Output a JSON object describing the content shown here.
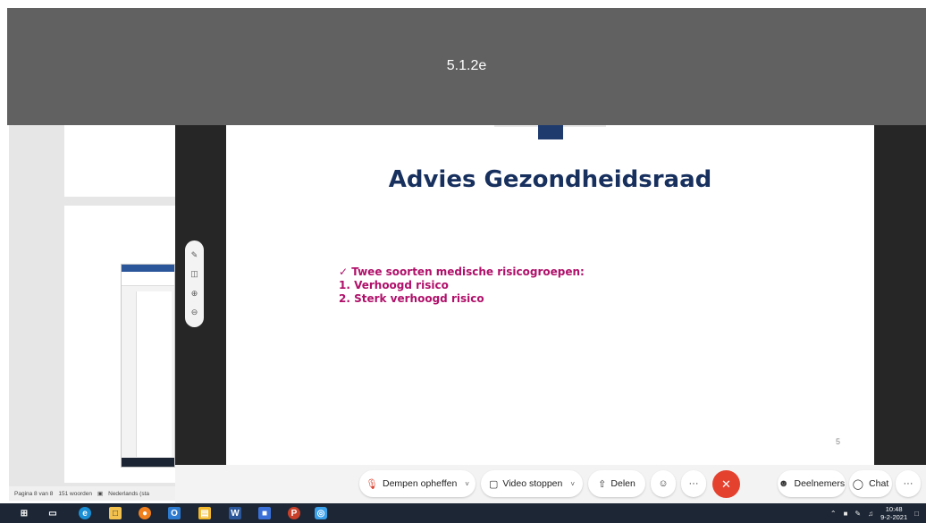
{
  "overlay": {
    "label": "5.1.2e"
  },
  "slide": {
    "title": "Advies Gezondheidsraad",
    "bullets": [
      "✓ Twee soorten medische risicogroepen:",
      "1.  Verhoogd risico",
      "2.  Sterk verhoogd risico"
    ],
    "page_number": "5"
  },
  "word": {
    "status_page": "Pagina 8 van 8",
    "status_words": "151 woorden",
    "status_language": "Nederlands (sta"
  },
  "controls": {
    "mute_label": "Dempen opheffen",
    "video_label": "Video stoppen",
    "share_label": "Delen",
    "more_label": "···",
    "participants_label": "Deelnemers",
    "chat_label": "Chat"
  },
  "icons": {
    "mic": "mic-off-icon",
    "video": "video-icon",
    "share": "share-icon",
    "reactions": "smiley-icon",
    "end": "close-icon"
  },
  "taskbar": {
    "time": "10:48",
    "date": "9-2-2021"
  },
  "colors": {
    "overlay": "#616161",
    "slide_title": "#17305e",
    "slide_bullets": "#b0106a",
    "end_call": "#e5412f",
    "taskbar": "#1c2635"
  }
}
